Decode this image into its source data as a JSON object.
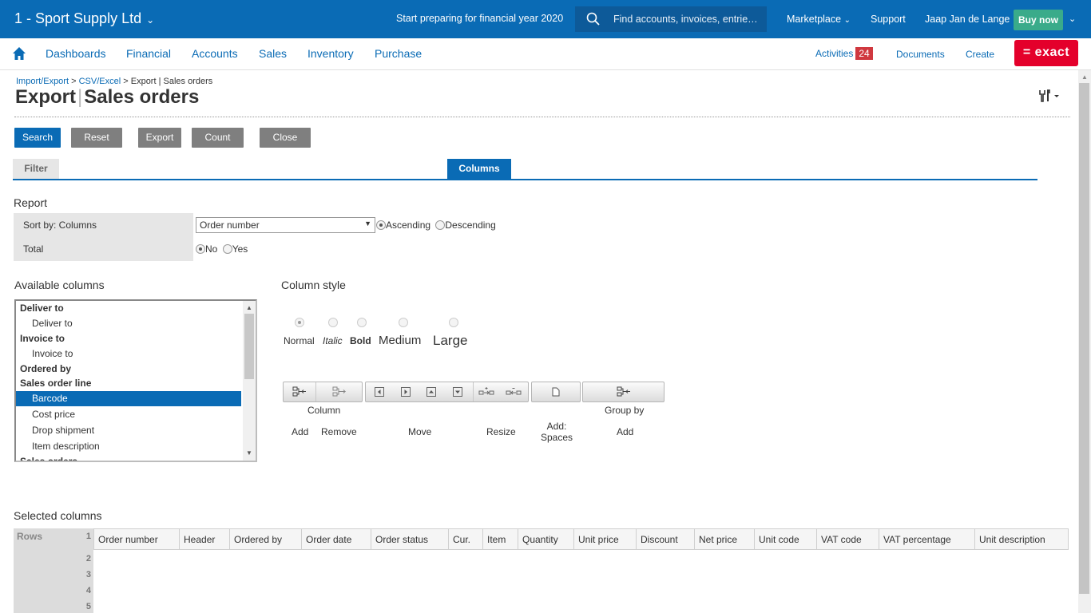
{
  "topbar": {
    "company": "1 - Sport Supply Ltd",
    "promo": "Start preparing for financial year 2020",
    "search_placeholder": "Find accounts, invoices, entrie…",
    "marketplace": "Marketplace",
    "support": "Support",
    "user": "Jaap Jan de Lange",
    "buy_now": "Buy now"
  },
  "nav": {
    "items": [
      "Dashboards",
      "Financial",
      "Accounts",
      "Sales",
      "Inventory",
      "Purchase"
    ],
    "activities": "Activities",
    "activities_count": "24",
    "documents": "Documents",
    "create": "Create",
    "logo": "= exact"
  },
  "breadcrumb": {
    "items": [
      "Import/Export",
      "CSV/Excel"
    ],
    "current": "Export | Sales orders",
    "sep": ">"
  },
  "page": {
    "title_a": "Export",
    "title_sep": "|",
    "title_b": "Sales orders"
  },
  "buttons": {
    "search": "Search",
    "reset": "Reset",
    "export": "Export",
    "count": "Count",
    "close": "Close"
  },
  "tabs": {
    "filter": "Filter",
    "columns": "Columns"
  },
  "report": {
    "heading": "Report",
    "sort_label": "Sort by: Columns",
    "sort_value": "Order number",
    "ascending": "Ascending",
    "descending": "Descending",
    "sort_direction": "Ascending",
    "total_label": "Total",
    "no": "No",
    "yes": "Yes",
    "total_value": "No"
  },
  "available": {
    "heading": "Available columns",
    "items": [
      {
        "label": "Deliver to",
        "kind": "group"
      },
      {
        "label": "Deliver to",
        "kind": "sub"
      },
      {
        "label": "Invoice to",
        "kind": "group"
      },
      {
        "label": "Invoice to",
        "kind": "sub"
      },
      {
        "label": "Ordered by",
        "kind": "group"
      },
      {
        "label": "Sales order line",
        "kind": "group"
      },
      {
        "label": "Barcode",
        "kind": "sub",
        "selected": true
      },
      {
        "label": "Cost price",
        "kind": "sub"
      },
      {
        "label": "Drop shipment",
        "kind": "sub"
      },
      {
        "label": "Item description",
        "kind": "sub"
      },
      {
        "label": "Sales orders",
        "kind": "group"
      }
    ]
  },
  "column_style": {
    "heading": "Column style",
    "options": [
      "Normal",
      "Italic",
      "Bold",
      "Medium",
      "Large"
    ],
    "selected": "Normal"
  },
  "toolbar_labels": {
    "column": "Column",
    "add": "Add",
    "remove": "Remove",
    "move": "Move",
    "resize": "Resize",
    "add_spaces": "Add:\nSpaces",
    "group_by": "Group by",
    "group_add": "Add"
  },
  "selected": {
    "heading": "Selected columns",
    "rows_label": "Rows",
    "row_numbers": [
      "1",
      "2",
      "3",
      "4",
      "5"
    ],
    "columns": [
      "Order number",
      "Header",
      "Ordered by",
      "Order date",
      "Order status",
      "Cur.",
      "Item",
      "Quantity",
      "Unit price",
      "Discount",
      "Net price",
      "Unit code",
      "VAT code",
      "VAT percentage",
      "Unit description"
    ]
  },
  "colors": {
    "brand_blue": "#0a6bb5",
    "buy_green": "#3aab8a",
    "logo_red": "#e4002b",
    "badge_red": "#d0383f"
  }
}
